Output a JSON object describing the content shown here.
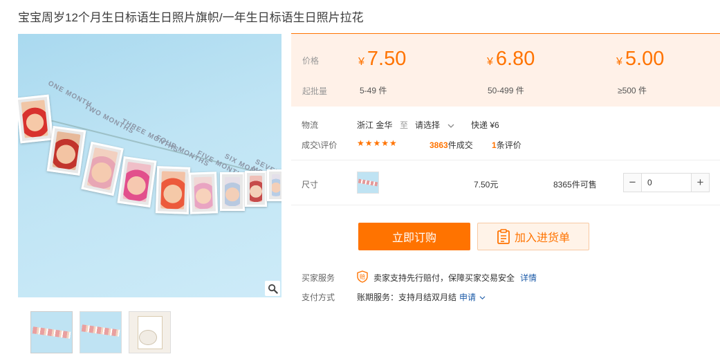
{
  "product": {
    "title": "宝宝周岁12个月生日标语生日照片旗帜/一年生日标语生日照片拉花"
  },
  "gallery": {
    "main_image_alt": "12个月宝宝照片拉花",
    "banner_words": [
      "ONE MONTH",
      "TWO MONTHS",
      "THREE MONTHS",
      "FOUR MONTHS",
      "FIVE MONTHS",
      "SIX MONTHS",
      "SEVEN MONTHS"
    ],
    "thumbnails": [
      "thumb-1",
      "thumb-2",
      "thumb-3"
    ]
  },
  "price_box": {
    "price_label": "价格",
    "qty_label": "起批量",
    "tiers": [
      {
        "currency": "¥",
        "price": "7.50",
        "range": "5-49",
        "unit": "件"
      },
      {
        "currency": "¥",
        "price": "6.80",
        "range": "50-499",
        "unit": "件"
      },
      {
        "currency": "¥",
        "price": "5.00",
        "range": "≥500",
        "unit": "件"
      }
    ]
  },
  "logistics": {
    "label": "物流",
    "from": "浙江 金华",
    "to_word": "至",
    "select": "请选择",
    "express": "快递 ¥6"
  },
  "deals": {
    "label": "成交\\评价",
    "stars": "★★★★★",
    "deal_count": "3863",
    "deal_suffix": "件成交",
    "review_count": "1",
    "review_suffix": "条评价"
  },
  "sku": {
    "label": "尺寸",
    "price": "7.50元",
    "stock": "8365件可售",
    "qty": "0",
    "minus": "−",
    "plus": "+"
  },
  "actions": {
    "order": "立即订购",
    "cart": "加入进货单"
  },
  "service": {
    "label": "买家服务",
    "text": "卖家支持先行赔付，保障买家交易安全",
    "link": "详情",
    "shield_glyph": "赔"
  },
  "payment": {
    "label": "支付方式",
    "text": "账期服务：支持月结双月结",
    "link": "申请"
  },
  "colors": {
    "accent": "#ff7300",
    "link": "#1c5ba8",
    "price_bg": "#fff1e8"
  }
}
